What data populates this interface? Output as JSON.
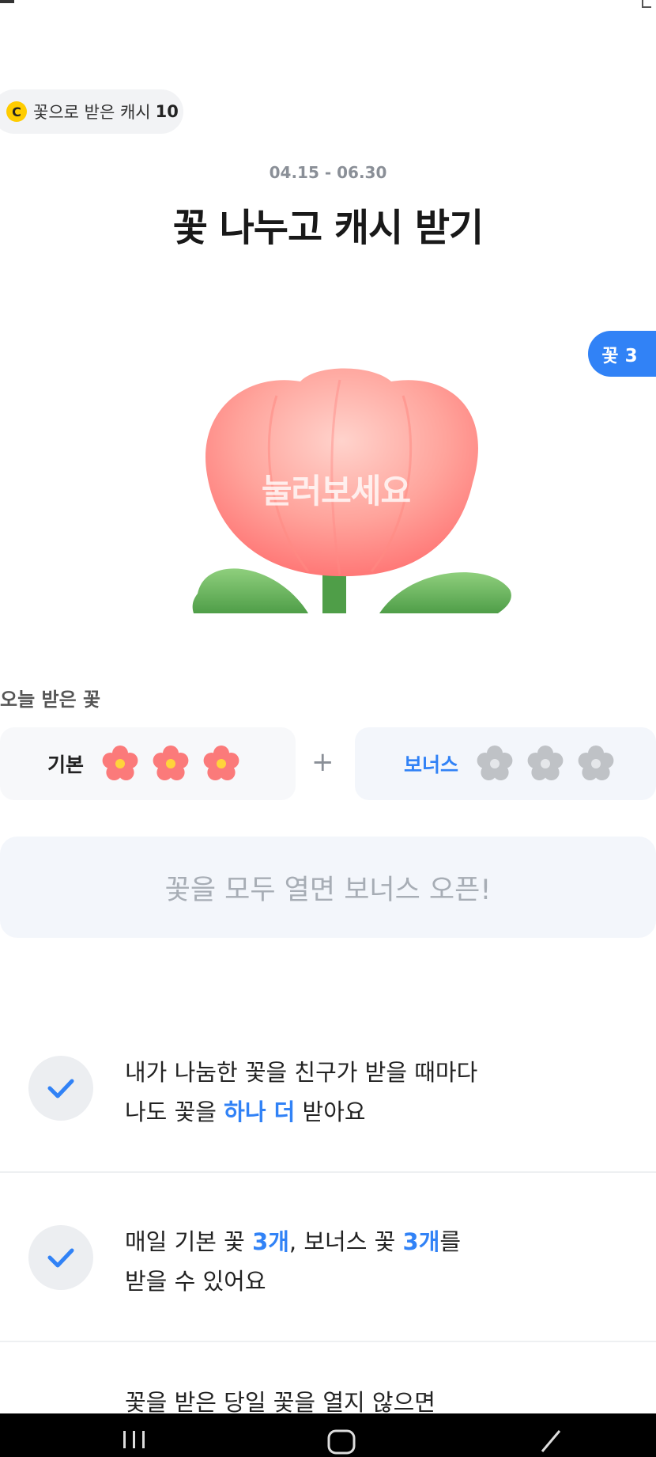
{
  "cash_chip": {
    "coin_icon": "C",
    "label": "꽃으로 받은 캐시",
    "value": "10"
  },
  "event": {
    "period": "04.15 - 06.30",
    "title": "꽃 나누고 캐시 받기"
  },
  "flower_badge": "꽃 3",
  "tulip": {
    "press_label": "눌러보세요"
  },
  "today": {
    "title": "오늘 받은 꽃",
    "basic_label": "기본",
    "basic_count": 3,
    "plus": "+",
    "bonus_label": "보너스",
    "bonus_count": 3
  },
  "bonus_banner": "꽃을 모두 열면 보너스 오픈!",
  "info": [
    {
      "line1": "내가 나눔한 꽃을 친구가 받을 때마다",
      "line2_pre": "나도 꽃을 ",
      "line2_hl": "하나 더",
      "line2_post": " 받아요"
    },
    {
      "line1_pre": "매일 기본 꽃 ",
      "line1_hl1": "3개",
      "line1_mid": ", 보너스 꽃 ",
      "line1_hl2": "3개",
      "line1_post": "를",
      "line2": "받을 수 있어요"
    },
    {
      "line1": "꽃을 받은 당일 꽃을 열지 않으면"
    }
  ],
  "colors": {
    "accent": "#3182f6",
    "flower_pink": "#fb7a7a",
    "coin": "#ffcc00"
  },
  "icons": {
    "check": "check-icon",
    "flower": "flower-icon",
    "nav_recent": "recent-apps-icon",
    "nav_home": "home-icon",
    "nav_back": "back-icon"
  }
}
